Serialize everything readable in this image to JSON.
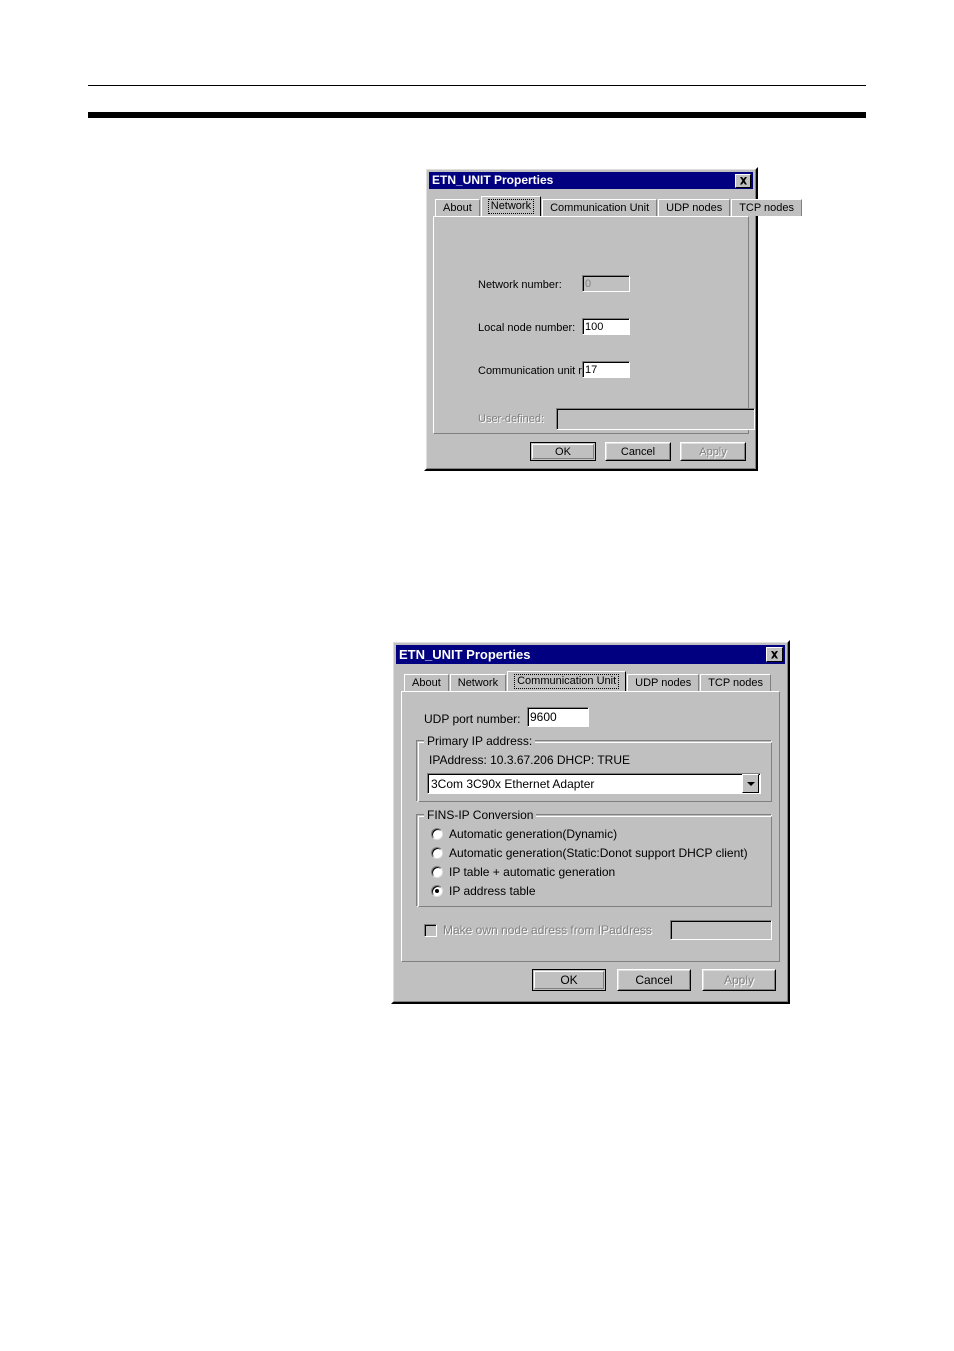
{
  "page": {
    "background": "#ffffff",
    "rule_color": "#000000"
  },
  "theme": {
    "dialog_face": "#c0c0c0",
    "titlebar": "#000080",
    "titlebar_text": "#ffffff",
    "field_bg": "#ffffff",
    "disabled_text": "#808080"
  },
  "dialog_network": {
    "title": "ETN_UNIT Properties",
    "close_icon": "close-icon",
    "tabs": [
      {
        "label": "About",
        "selected": false
      },
      {
        "label": "Network",
        "selected": true
      },
      {
        "label": "Communication Unit",
        "selected": false
      },
      {
        "label": "UDP nodes",
        "selected": false
      },
      {
        "label": "TCP nodes",
        "selected": false
      }
    ],
    "fields": [
      {
        "label": "Network number:",
        "value": "0",
        "disabled": true
      },
      {
        "label": "Local node number:",
        "value": "100",
        "disabled": false
      },
      {
        "label": "Communication unit number:",
        "value": "17",
        "disabled": false
      },
      {
        "label": "User-defined:",
        "value": "",
        "disabled": true
      }
    ],
    "buttons": [
      {
        "label": "OK",
        "style": "default",
        "disabled": false
      },
      {
        "label": "Cancel",
        "style": "normal",
        "disabled": false
      },
      {
        "label": "Apply",
        "style": "normal",
        "disabled": true
      }
    ]
  },
  "dialog_comm_unit": {
    "title": "ETN_UNIT Properties",
    "close_icon": "close-icon",
    "tabs": [
      {
        "label": "About",
        "selected": false
      },
      {
        "label": "Network",
        "selected": false
      },
      {
        "label": "Communication Unit",
        "selected": true
      },
      {
        "label": "UDP nodes",
        "selected": false
      },
      {
        "label": "TCP nodes",
        "selected": false
      }
    ],
    "udp_port": {
      "label": "UDP port number:",
      "value": "9600"
    },
    "primary_ip": {
      "group_title": "Primary IP address:",
      "info": "IPAddress: 10.3.67.206   DHCP: TRUE",
      "adapter_selected": "3Com 3C90x Ethernet Adapter",
      "dropdown_icon": "chevron-down-icon"
    },
    "fins_ip": {
      "group_title": "FINS-IP Conversion",
      "options": [
        {
          "label": "Automatic generation(Dynamic)",
          "selected": false
        },
        {
          "label": "Automatic generation(Static:Donot support DHCP client)",
          "selected": false
        },
        {
          "label": "IP table + automatic generation",
          "selected": false
        },
        {
          "label": "IP address table",
          "selected": true
        }
      ]
    },
    "own_node": {
      "label": "Make own node adress from IPaddress",
      "checked": false,
      "disabled": true,
      "value": ""
    },
    "buttons": [
      {
        "label": "OK",
        "style": "default",
        "disabled": false
      },
      {
        "label": "Cancel",
        "style": "normal",
        "disabled": false
      },
      {
        "label": "Apply",
        "style": "normal",
        "disabled": true
      }
    ]
  }
}
